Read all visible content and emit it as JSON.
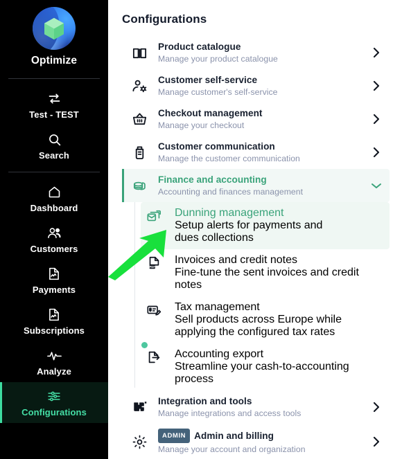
{
  "sidebar": {
    "brand": {
      "name": "Optimize",
      "logo_icon": "optimize-logo"
    },
    "items": [
      {
        "label": "Test - TEST",
        "icon": "switch-arrows-icon",
        "active": false
      },
      {
        "label": "Search",
        "icon": "search-icon",
        "active": false
      },
      {
        "label": "Dashboard",
        "icon": "home-icon",
        "active": false
      },
      {
        "label": "Customers",
        "icon": "users-icon",
        "active": false
      },
      {
        "label": "Payments",
        "icon": "document-chart-icon",
        "active": false
      },
      {
        "label": "Subscriptions",
        "icon": "document-chart-icon",
        "active": false
      },
      {
        "label": "Analyze",
        "icon": "pulse-icon",
        "active": false
      },
      {
        "label": "Configurations",
        "icon": "sliders-icon",
        "active": true
      }
    ]
  },
  "main": {
    "page_title": "Configurations",
    "rows": [
      {
        "title": "Product catalogue",
        "subtitle": "Manage your product catalogue",
        "icon": "book-icon",
        "chevron": "chevron-right-icon"
      },
      {
        "title": "Customer self-service",
        "subtitle": "Manage customer's self-service",
        "icon": "user-gear-icon",
        "chevron": "chevron-right-icon"
      },
      {
        "title": "Checkout management",
        "subtitle": "Manage your checkout",
        "icon": "basket-icon",
        "chevron": "chevron-right-icon"
      },
      {
        "title": "Customer communication",
        "subtitle": "Manage the customer communication",
        "icon": "megaphone-icon",
        "chevron": "chevron-right-icon"
      }
    ],
    "expanded_row": {
      "title": "Finance and accounting",
      "subtitle": "Accounting and finances management",
      "icon": "coins-stack-icon",
      "chevron": "chevron-down-icon"
    },
    "sub_rows": [
      {
        "title": "Dunning management",
        "subtitle": "Setup alerts for payments and dues collections",
        "icon": "mail-cards-icon",
        "selected": true,
        "dot": false
      },
      {
        "title": "Invoices and credit notes",
        "subtitle": "Fine-tune the sent invoices and credit notes",
        "icon": "pdf-file-icon",
        "selected": false,
        "dot": false
      },
      {
        "title": "Tax management",
        "subtitle": "Sell products across Europe while applying the configured tax rates",
        "icon": "tax-edit-icon",
        "selected": false,
        "dot": false
      },
      {
        "title": "Accounting export",
        "subtitle": "Streamline your cash-to-accounting process",
        "icon": "export-file-icon",
        "selected": false,
        "dot": true
      }
    ],
    "trailing_rows": [
      {
        "title": "Integration and tools",
        "subtitle": "Manage integrations and access tools",
        "icon": "puzzle-icon",
        "chevron": "chevron-right-icon",
        "badge": ""
      },
      {
        "title": "Admin and billing",
        "subtitle": "Manage your account and organization",
        "icon": "gear-icon",
        "chevron": "chevron-right-icon",
        "badge": "ADMIN"
      }
    ]
  },
  "annotation": {
    "icon": "green-arrow-annotation",
    "color": "#18E03C"
  },
  "colors": {
    "accent_green": "#3aa37a",
    "sidebar_bg": "#000000",
    "sidebar_active_bg": "#071a12",
    "sidebar_active_text": "#45dfa6",
    "title_text": "#18202f",
    "subtitle_text": "#8a92ab",
    "badge_admin_bg": "#44627a",
    "dot_badge": "#4dc79f"
  }
}
